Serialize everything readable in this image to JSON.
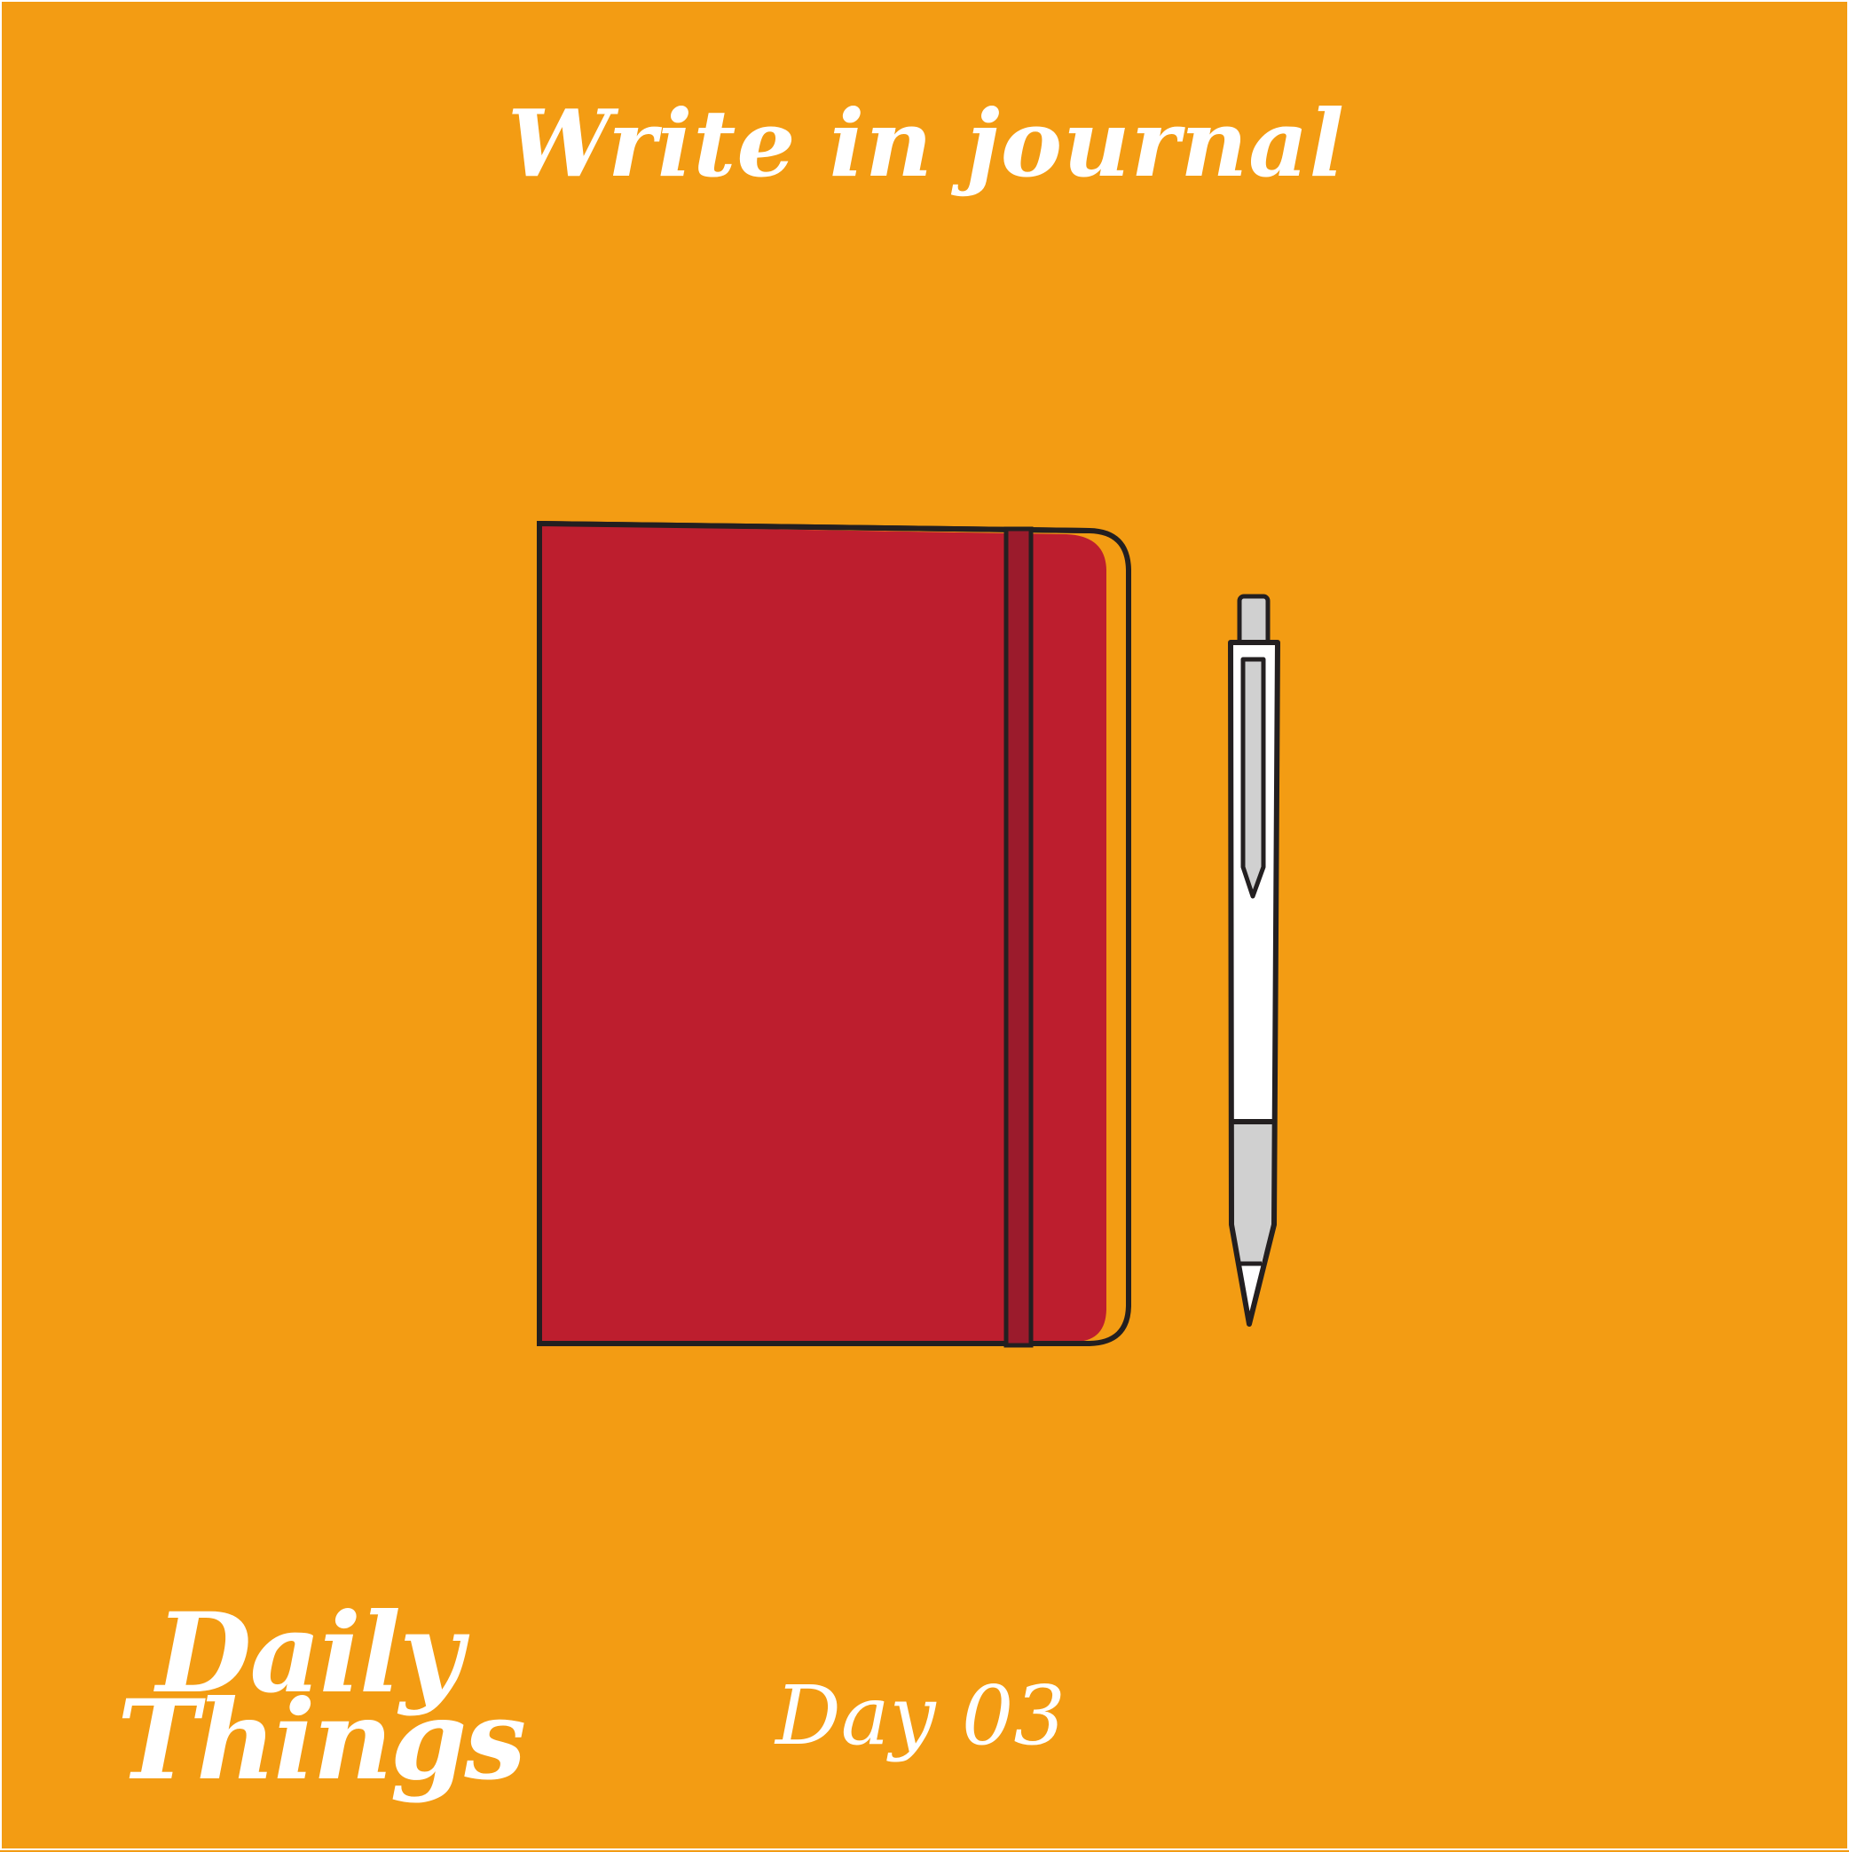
{
  "title": "Write in journal",
  "logo": {
    "line1": "Daily",
    "line2": "Things"
  },
  "day_label": "Day 03",
  "colors": {
    "background": "#f39c13",
    "journal_cover": "#bd1e2e",
    "journal_band": "#9b1b2c",
    "outline": "#231f20",
    "pen_body": "#ffffff",
    "pen_grip": "#d0d0d0",
    "text": "#ffffff"
  },
  "icons": [
    "journal-icon",
    "pen-icon"
  ]
}
